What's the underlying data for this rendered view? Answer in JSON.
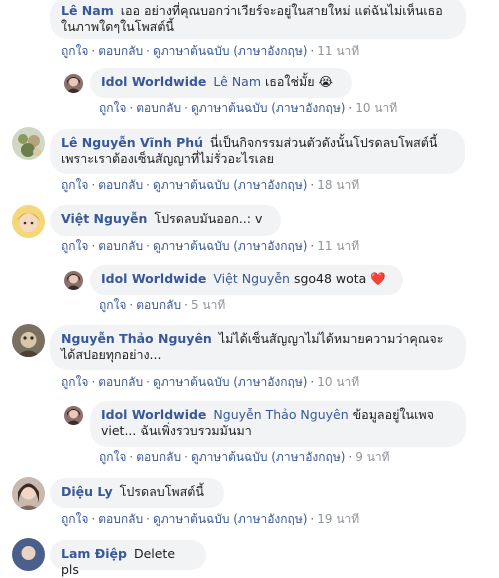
{
  "actions": {
    "like": "ถูกใจ",
    "reply": "ตอบกลับ",
    "see_original": "ดูภาษาต้นฉบับ (ภาษาอังกฤษ)",
    "dot": "·"
  },
  "comments": [
    {
      "author": "Lê Nam",
      "text": "เออ อย่างที่คุณบอกว่าเวียร์จะอยู่ในสายใหม่ แต่ฉันไม่เห็นเธอในภาพใดๆในโพสต์นี้",
      "time": "11 นาที",
      "reply": {
        "author": "Idol Worldwide",
        "mention": "Lê Nam",
        "text": "เธอใช่มั้ย",
        "emoji": "😭",
        "time": "10 นาที"
      }
    },
    {
      "author": "Lê Nguyễn Vĩnh Phú",
      "text": "นี่เป็นกิจกรรมส่วนตัวดังนั้นโปรดลบโพสต์นี้เพราะเราต้องเซ็นสัญญาที่ไม่รั่วอะไรเลย",
      "time": "18 นาที"
    },
    {
      "author": "Việt Nguyễn",
      "text": "โปรดลบมันออก..: v",
      "time": "11 นาที",
      "reply": {
        "author": "Idol Worldwide",
        "mention": "Việt Nguyễn",
        "text": "sgo48 wota",
        "emoji": "❤️",
        "time": "5 นาที"
      }
    },
    {
      "author": "Nguyễn Thảo Nguyên",
      "text": "ไม่ได้เซ็นสัญญาไม่ได้หมายความว่าคุณจะได้สปอยทุกอย่าง...",
      "time": "10 นาที",
      "reply": {
        "author": "Idol Worldwide",
        "mention": "Nguyễn Thảo Nguyên",
        "text": "ข้อมูลอยู่ในเพจ viet... ฉันเพิ่งรวบรวมมันมา",
        "time": "9 นาที"
      }
    },
    {
      "author": "Diệu Ly",
      "text": "โปรดลบโพสต์นี้",
      "time": "19 นาที"
    },
    {
      "author": "Lam Điệp",
      "text": "Delete pls"
    }
  ],
  "colors": {
    "link": "#385898",
    "bubble": "#f2f3f5",
    "meta": "#606770"
  }
}
